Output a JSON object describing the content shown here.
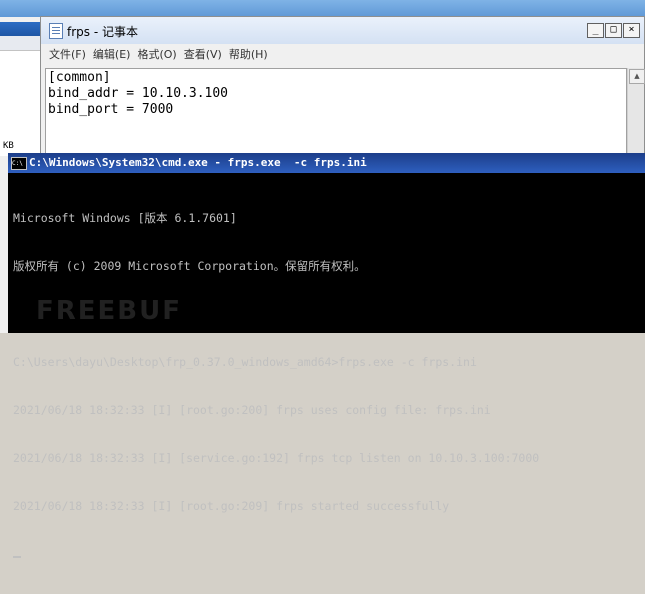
{
  "background_window": {
    "status_text": "KB"
  },
  "notepad": {
    "title": "frps - 记事本",
    "controls": [
      "_",
      "□",
      "×"
    ],
    "menu": [
      "文件(F)",
      "编辑(E)",
      "格式(O)",
      "查看(V)",
      "帮助(H)"
    ],
    "content_lines": [
      "[common]",
      "bind_addr = 10.10.3.100",
      "bind_port = 7000"
    ]
  },
  "cmd": {
    "title": "C:\\Windows\\System32\\cmd.exe - frps.exe  -c frps.ini",
    "lines": [
      "Microsoft Windows [版本 6.1.7601]",
      "版权所有 (c) 2009 Microsoft Corporation。保留所有权利。",
      "",
      "C:\\Users\\dayu\\Desktop\\frp_0.37.0_windows_amd64>frps.exe -c frps.ini",
      "2021/06/18 18:32:33 [I] [root.go:200] frps uses config file: frps.ini",
      "2021/06/18 18:32:33 [I] [service.go:192] frps tcp listen on 10.10.3.100:7000",
      "2021/06/18 18:32:33 [I] [root.go:209] frps started successfully"
    ]
  },
  "watermark": "FREEBUF"
}
